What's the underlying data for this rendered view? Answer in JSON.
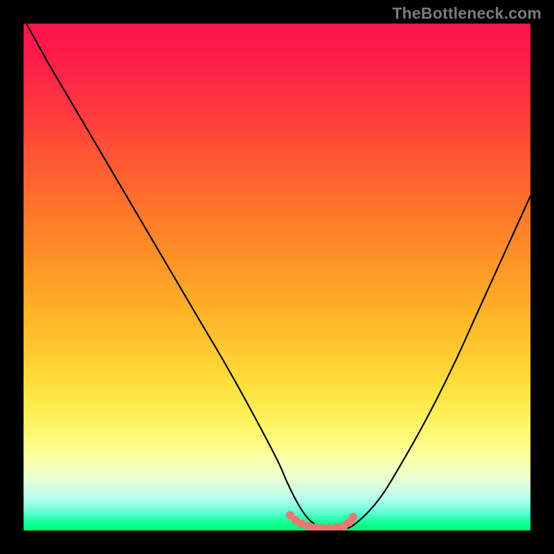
{
  "watermark": "TheBottleneck.com",
  "colors": {
    "frame_bg": "#000000",
    "curve_stroke": "#000000",
    "marker_fill": "#e87a72",
    "gradient_top": "#ff1450",
    "gradient_bottom": "#00f87c"
  },
  "chart_data": {
    "type": "line",
    "title": "",
    "xlabel": "",
    "ylabel": "",
    "xlim": [
      0,
      100
    ],
    "ylim": [
      0,
      100
    ],
    "grid": false,
    "legend": false,
    "annotations": [],
    "series": [
      {
        "name": "bottleneck-curve",
        "x": [
          0,
          5,
          10,
          15,
          20,
          25,
          30,
          35,
          40,
          45,
          50,
          52,
          54,
          56,
          58,
          60,
          62,
          65,
          70,
          75,
          80,
          85,
          90,
          95,
          100
        ],
        "y": [
          101,
          92,
          83.5,
          75,
          66.5,
          58,
          49.5,
          41,
          32.5,
          23.5,
          14,
          9.5,
          5.5,
          2.5,
          0.9,
          0.3,
          0.3,
          1.0,
          6,
          14,
          23,
          33,
          44,
          55,
          66
        ]
      }
    ],
    "markers": {
      "name": "valley-dots",
      "x": [
        52.6,
        53.7,
        54.9,
        56.2,
        57.6,
        59.0,
        60.4,
        61.8,
        63.2,
        64.2,
        65.0
      ],
      "y": [
        3.0,
        2.0,
        1.3,
        0.8,
        0.55,
        0.45,
        0.45,
        0.6,
        0.9,
        1.6,
        2.6
      ]
    },
    "background_gradient": {
      "orientation": "vertical",
      "maps_to": "y",
      "stops": [
        {
          "y": 100,
          "color": "#ff1450"
        },
        {
          "y": 50,
          "color": "#ff9a26"
        },
        {
          "y": 20,
          "color": "#fff072"
        },
        {
          "y": 8,
          "color": "#d8ffd8"
        },
        {
          "y": 0,
          "color": "#00f87c"
        }
      ]
    }
  }
}
